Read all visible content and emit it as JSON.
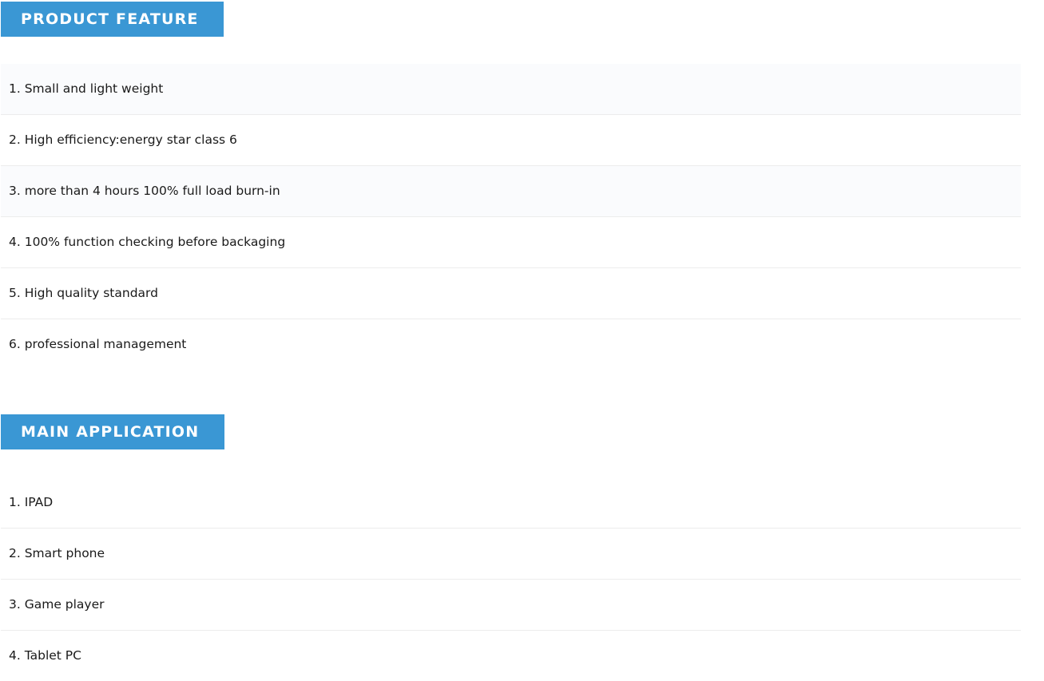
{
  "feature_section": {
    "title": "PRODUCT FEATURE",
    "items": [
      "1. Small and light weight",
      "2. High efficiency:energy star class 6",
      "3. more than 4 hours 100% full load burn-in",
      "4. 100% function checking before backaging",
      "5. High quality standard",
      "6. professional management"
    ]
  },
  "application_section": {
    "title": "MAIN APPLICATION",
    "items": [
      "1. IPAD",
      "2. Smart phone",
      "3. Game player",
      "4. Tablet PC"
    ]
  },
  "colors": {
    "header_bg": "#3a97d4",
    "header_text": "#ffffff",
    "row_divider": "#ececec"
  }
}
